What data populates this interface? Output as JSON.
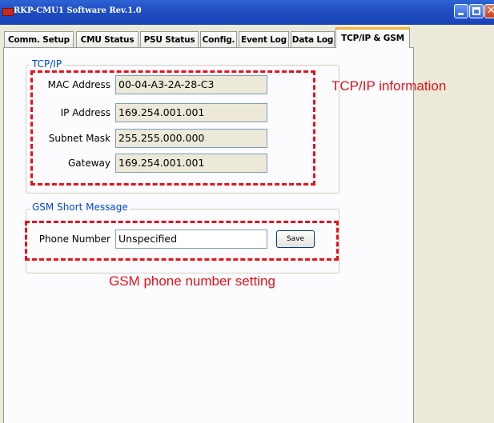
{
  "window": {
    "title": "RKP-CMU1 Software  Rev.1.0"
  },
  "tabs": [
    {
      "label": "Comm. Setup",
      "active": false
    },
    {
      "label": "CMU Status",
      "active": false
    },
    {
      "label": "PSU Status",
      "active": false
    },
    {
      "label": "Config.",
      "active": false
    },
    {
      "label": "Event Log",
      "active": false
    },
    {
      "label": "Data Log",
      "active": false
    },
    {
      "label": "TCP/IP & GSM",
      "active": true
    }
  ],
  "tcpip": {
    "legend": "TCP/IP",
    "mac_label": "MAC Address",
    "mac_value": "00-04-A3-2A-28-C3",
    "ip_label": "IP Address",
    "ip_value": "169.254.001.001",
    "subnet_label": "Subnet Mask",
    "subnet_value": "255.255.000.000",
    "gateway_label": "Gateway",
    "gateway_value": "169.254.001.001"
  },
  "gsm": {
    "legend": "GSM Short Message",
    "phone_label": "Phone Number",
    "phone_value": "Unspecified",
    "save_label": "Save"
  },
  "annotations": {
    "tcpip": "TCP/IP information",
    "gsm": "GSM phone number setting",
    "color": "#e8101a"
  },
  "colors": {
    "titlebar": "#1f4fc3",
    "legend": "#0046d5",
    "active_tab_accent": "#f7b23b"
  }
}
